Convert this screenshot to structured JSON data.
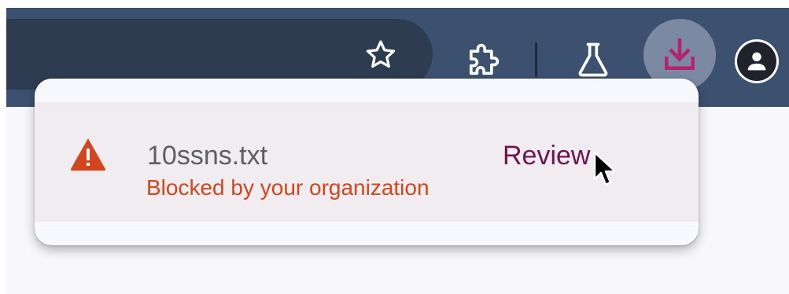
{
  "toolbar": {
    "icons": {
      "star": "star-outline-icon",
      "extensions": "puzzle-piece-icon",
      "labs": "flask-icon",
      "downloads": "download-icon",
      "profile": "person-icon"
    },
    "colors": {
      "toolbar_bg": "#3c5170",
      "omnibox_bg": "#2d3c51",
      "download_accent": "#b5226d"
    }
  },
  "download_bubble": {
    "item": {
      "filename": "10ssns.txt",
      "status": "Blocked by your organization",
      "action_label": "Review",
      "warning_icon": "warning-triangle-icon",
      "colors": {
        "status": "#d2451f",
        "action": "#6b1650"
      }
    }
  }
}
